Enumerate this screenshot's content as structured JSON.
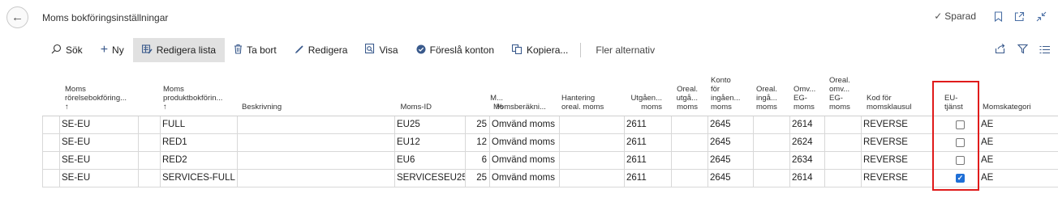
{
  "page": {
    "title": "Moms bokföringsinställningar",
    "saved_label": "Sparad"
  },
  "actions": [
    {
      "label": "Sök",
      "icon": "search-icon"
    },
    {
      "label": "Ny",
      "icon": "plus-icon"
    },
    {
      "label": "Redigera lista",
      "icon": "edit-list-icon"
    },
    {
      "label": "Ta bort",
      "icon": "trash-icon"
    },
    {
      "label": "Redigera",
      "icon": "pencil-icon"
    },
    {
      "label": "Visa",
      "icon": "view-icon"
    },
    {
      "label": "Föreslå konton",
      "icon": "check-circle-icon"
    },
    {
      "label": "Kopiera...",
      "icon": "copy-icon"
    }
  ],
  "more_label": "Fler alternativ",
  "columns": {
    "bus_l1": "Moms",
    "bus_l2": "rörelsebokföring...",
    "bus_l3": "↑",
    "prod_l1": "Moms",
    "prod_l2": "produktbokförin...",
    "prod_l3": "↑",
    "desc": "Beskrivning",
    "id": "Moms-ID",
    "pct_l1": "M...",
    "pct_l2": "%",
    "calc": "Momsberäkni...",
    "nonded_l1": "Hantering",
    "nonded_l2": "oreal. moms",
    "sales_l1": "Utgåen...",
    "sales_l2": "moms",
    "unrsales_l1": "Oreal.",
    "unrsales_l2": "utgå...",
    "unrsales_l3": "moms",
    "purch_l1": "Konto",
    "purch_l2": "för",
    "purch_l3": "ingåen...",
    "purch_l4": "moms",
    "unrpurch_l1": "Oreal.",
    "unrpurch_l2": "ingå...",
    "unrpurch_l3": "moms",
    "rev_l1": "Omv...",
    "rev_l2": "EG-",
    "rev_l3": "moms",
    "unrrev_l1": "Oreal.",
    "unrrev_l2": "omv...",
    "unrrev_l3": "EG-",
    "unrrev_l4": "moms",
    "clause_l1": "Kod för",
    "clause_l2": "momsklausul",
    "eu_l1": "EU-",
    "eu_l2": "tjänst",
    "cat": "Momskategori"
  },
  "rows": [
    {
      "bus": "SE-EU",
      "prod": "FULL",
      "desc": "",
      "id": "EU25",
      "pct": "25",
      "calc": "Omvänd moms",
      "nonded": "",
      "sales": "2611",
      "unrsales": "",
      "purch": "2645",
      "unrpurch": "",
      "rev": "2614",
      "unrrev": "",
      "clause": "REVERSE",
      "eu": false,
      "cat": "AE"
    },
    {
      "bus": "SE-EU",
      "prod": "RED1",
      "desc": "",
      "id": "EU12",
      "pct": "12",
      "calc": "Omvänd moms",
      "nonded": "",
      "sales": "2611",
      "unrsales": "",
      "purch": "2645",
      "unrpurch": "",
      "rev": "2624",
      "unrrev": "",
      "clause": "REVERSE",
      "eu": false,
      "cat": "AE"
    },
    {
      "bus": "SE-EU",
      "prod": "RED2",
      "desc": "",
      "id": "EU6",
      "pct": "6",
      "calc": "Omvänd moms",
      "nonded": "",
      "sales": "2611",
      "unrsales": "",
      "purch": "2645",
      "unrpurch": "",
      "rev": "2634",
      "unrrev": "",
      "clause": "REVERSE",
      "eu": false,
      "cat": "AE"
    },
    {
      "bus": "SE-EU",
      "prod": "SERVICES-FULL",
      "desc": "",
      "id": "SERVICESEU25",
      "pct": "25",
      "calc": "Omvänd moms",
      "nonded": "",
      "sales": "2611",
      "unrsales": "",
      "purch": "2645",
      "unrpurch": "",
      "rev": "2614",
      "unrrev": "",
      "clause": "REVERSE",
      "eu": true,
      "cat": "AE"
    }
  ],
  "colors": {
    "highlight_box": "#e01b1b",
    "checkbox_on": "#1f6fd6",
    "active_action_bg": "#e1e1e1"
  }
}
